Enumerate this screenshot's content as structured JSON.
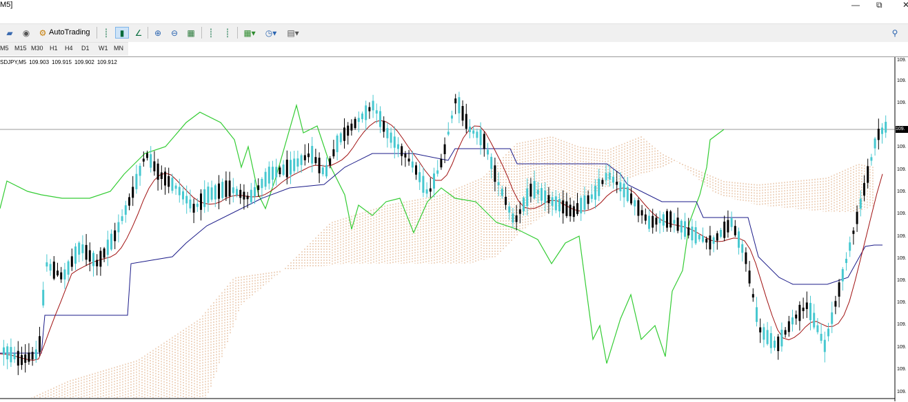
{
  "window": {
    "title": "M5]"
  },
  "toolbar": {
    "autotrading_label": "AutoTrading"
  },
  "timeframes": [
    "M5",
    "M15",
    "M30",
    "H1",
    "H4",
    "D1",
    "W1",
    "MN"
  ],
  "chart": {
    "symbol": "SDJPY,M5",
    "open": "109.903",
    "high": "109.915",
    "low": "109.902",
    "close": "109.912",
    "current_price_label": "109.",
    "price_axis_labels": [
      "109.",
      "109.",
      "109.",
      "109.",
      "109.",
      "109.",
      "109.",
      "109.",
      "109.",
      "109.",
      "109.",
      "109.",
      "109.",
      "109.",
      "109."
    ],
    "colors": {
      "background": "#ffffff",
      "bull_candle": "#47c8d0",
      "bear_candle": "#000000",
      "tenkan": "#a01010",
      "kijun": "#1a1a88",
      "chikou": "#33cc33",
      "cloud": "#d89a66",
      "current_price_line": "#9a9a9a"
    }
  }
}
